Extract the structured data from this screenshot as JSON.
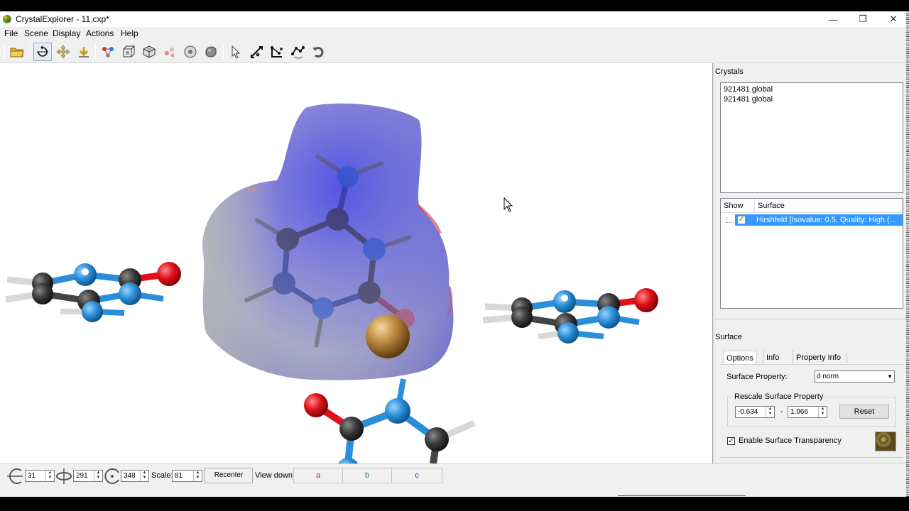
{
  "window": {
    "title": "CrystalExplorer - 11.cxp*",
    "minimize": "—",
    "maximize": "❐",
    "close": "✕"
  },
  "menu": [
    "File",
    "Scene",
    "Display",
    "Actions",
    "Help"
  ],
  "toolbar": {
    "icons": [
      "open-folder-icon",
      "rotate-icon",
      "translate-icon",
      "scale-icon",
      "atoms-icon",
      "cell-icon",
      "box-icon",
      "fragment-icon",
      "sphere-icon",
      "surface-icon",
      "pointer-icon",
      "distance-icon",
      "angle-icon",
      "torsion-icon",
      "undo-icon"
    ]
  },
  "crystals": {
    "label": "Crystals",
    "items": [
      "921481 global",
      "921481 global"
    ]
  },
  "surfaces_table": {
    "headers": [
      "Show",
      "Surface"
    ],
    "rows": [
      {
        "checked": true,
        "name": "Hirshfeld [Isovalue: 0.5, Quality: High (..."
      }
    ]
  },
  "surface_panel": {
    "label": "Surface",
    "tabs": [
      "Options",
      "Info",
      "Property Info"
    ],
    "active_tab": "Options",
    "surface_property_label": "Surface Property:",
    "surface_property_value": "d norm",
    "rescale_title": "Rescale Surface Property",
    "min": "-0.634",
    "dash": "-",
    "max": "1.066",
    "reset_label": "Reset",
    "transparency_label": "Enable Surface Transparency",
    "transparency_checked": true
  },
  "statusbar": {
    "rot_x": "31",
    "rot_y": "291",
    "rot_z": "348",
    "scale_label": "Scale:",
    "scale": "81",
    "recenter_label": "Recenter",
    "viewdown_label": "View down:",
    "axes": [
      "a",
      "b",
      "c"
    ]
  },
  "colors": {
    "atom_carbon": "#3a3a3a",
    "atom_nitrogen": "#2a8fd8",
    "atom_oxygen": "#e0101a",
    "atom_hydrogen": "#e8e8e8",
    "atom_bromine": "#b8863c",
    "surface_blue": "#3f3fe0",
    "selection": "#3399ff"
  }
}
